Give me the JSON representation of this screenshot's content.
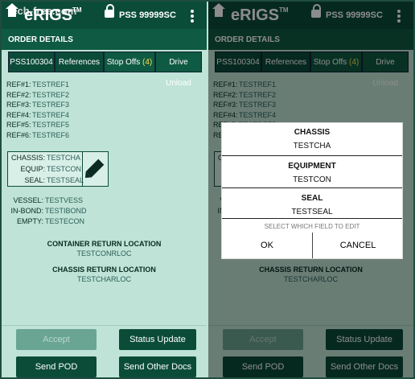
{
  "app": {
    "title": "eRIGS",
    "trademark": "TM",
    "pss": "PSS 99999SC",
    "watermark": "tech-free.com"
  },
  "order": {
    "header": "ORDER DETAILS"
  },
  "tabs": [
    {
      "label": "PSS100304"
    },
    {
      "label": "References"
    },
    {
      "label": "Stop Offs",
      "count": "(4)"
    },
    {
      "label": "Drive Unload"
    }
  ],
  "refs": [
    {
      "key": "REF#1:",
      "value": "TESTREF1"
    },
    {
      "key": "REF#2:",
      "value": "TESTREF2"
    },
    {
      "key": "REF#3:",
      "value": "TESTREF3"
    },
    {
      "key": "REF#4:",
      "value": "TESTREF4"
    },
    {
      "key": "REF#5:",
      "value": "TESTREF5"
    },
    {
      "key": "REF#6:",
      "value": "TESTREF6"
    }
  ],
  "equipment_box": {
    "chassis_key": "CHASSIS:",
    "chassis_val": "TESTCHA",
    "equip_key": "EQUIP:",
    "equip_val": "TESTCON",
    "seal_key": "SEAL:",
    "seal_val": "TESTSEAL"
  },
  "vessel": {
    "vessel_key": "VESSEL:",
    "vessel_val": "TESTVESS",
    "inbond_key": "IN-BOND:",
    "inbond_val": "TESTIBOND",
    "empty_key": "EMPTY:",
    "empty_val": "TESTECON"
  },
  "returns": {
    "container_header": "CONTAINER RETURN LOCATION",
    "container_val": "TESTCONRLOC",
    "chassis_header": "CHASSIS RETURN LOCATION",
    "chassis_val": "TESTCHARLOC"
  },
  "buttons": {
    "accept": "Accept",
    "status": "Status Update",
    "send_pod": "Send POD",
    "send_docs": "Send Other Docs"
  },
  "dialog": {
    "chassis_h": "CHASSIS",
    "chassis_v": "TESTCHA",
    "equip_h": "EQUIPMENT",
    "equip_v": "TESTCON",
    "seal_h": "SEAL",
    "seal_v": "TESTSEAL",
    "hint": "SELECT WHICH FIELD TO EDIT",
    "ok": "OK",
    "cancel": "CANCEL"
  }
}
